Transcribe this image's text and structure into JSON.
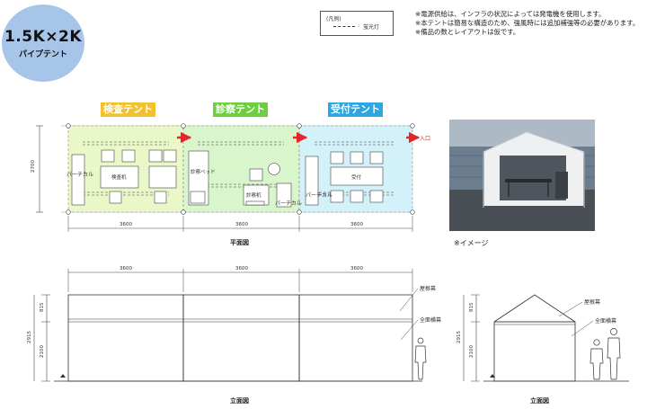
{
  "badge": {
    "size": "1.5K×2K",
    "name": "パイプテント"
  },
  "legend": {
    "title": "(凡例)",
    "colon": ":",
    "item": "蛍光灯"
  },
  "notes": [
    "※電源供給は、インフラの状況によっては発電機を使用します。",
    "※本テントは簡易な構造のため、強風時には追加補強等の必要があります。",
    "※備品の数とレイアウトは仮です。"
  ],
  "tents": [
    {
      "name": "検査テント",
      "color": "#f3c12e",
      "fill": "#eaf7c8"
    },
    {
      "name": "診察テント",
      "color": "#6ccf3f",
      "fill": "#d8f5cc"
    },
    {
      "name": "受付テント",
      "color": "#2ea6e0",
      "fill": "#d2f1f8"
    }
  ],
  "plan": {
    "caption": "平面図",
    "depth": "2700",
    "widths": [
      "3600",
      "3600",
      "3600"
    ],
    "entrance": "入口",
    "labels": {
      "partition_left": "パーチカル",
      "exam_desk": "検査机",
      "exam_bed": "診察ベッド",
      "consult_desk": "診察机",
      "partition_mid": "パーチカル",
      "partition_right": "パーチカル",
      "reception": "受付"
    }
  },
  "elevation_front": {
    "caption": "立面図",
    "widths": [
      "3600",
      "3600",
      "3600"
    ],
    "dims": [
      "815",
      "2915",
      "2100"
    ],
    "labels": {
      "roof": "屋根幕",
      "side": "全面横幕"
    }
  },
  "elevation_side": {
    "caption": "立面図",
    "dims": [
      "815",
      "2915",
      "2100"
    ],
    "labels": {
      "roof": "屋根幕",
      "side": "全面横幕"
    }
  },
  "photo": {
    "caption": "※イメージ"
  }
}
